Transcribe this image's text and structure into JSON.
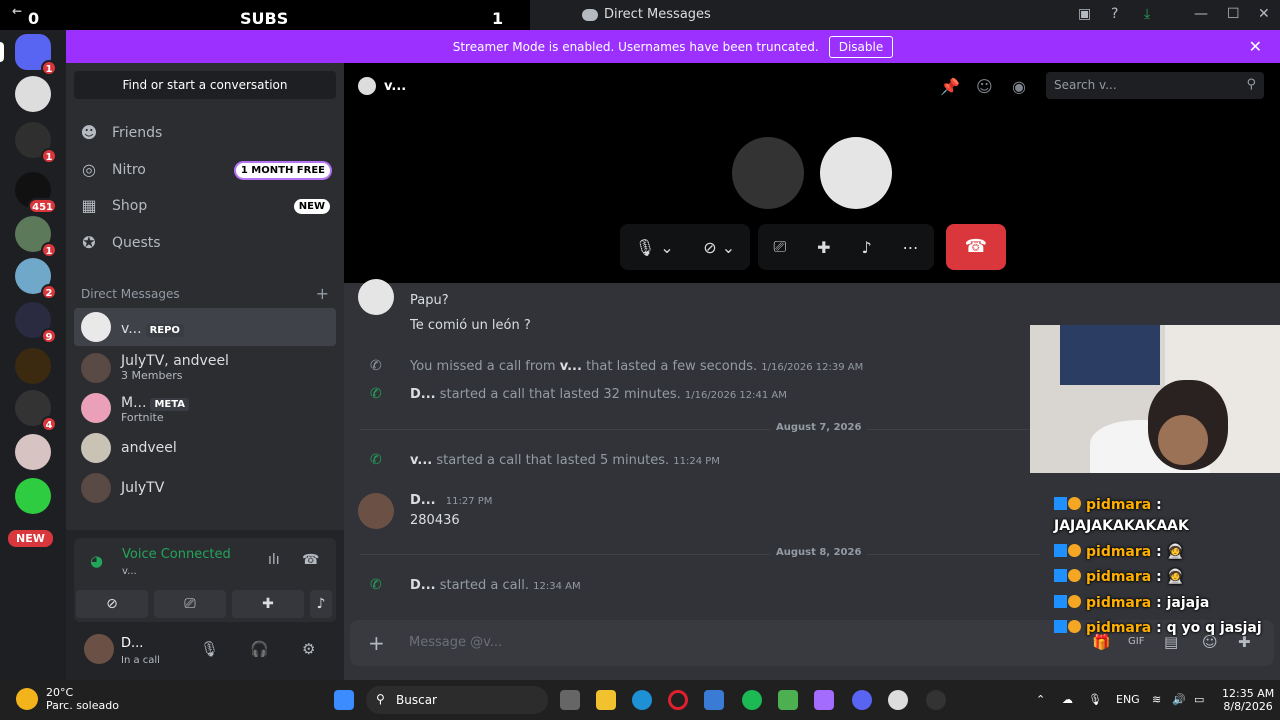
{
  "overlay": {
    "left_count": "0",
    "label": "SUBS",
    "right_count": "1"
  },
  "window": {
    "title": "Direct Messages"
  },
  "banner": {
    "text": "Streamer Mode is enabled. Usernames have been truncated.",
    "button": "Disable"
  },
  "server_badges": [
    "1",
    "1",
    "451",
    "1",
    "2",
    "9",
    "4"
  ],
  "server_new": "NEW",
  "sidebar": {
    "find": "Find or start a conversation",
    "nav": [
      {
        "label": "Friends",
        "tag": ""
      },
      {
        "label": "Nitro",
        "tag": "1 MONTH FREE"
      },
      {
        "label": "Shop",
        "tag": "NEW"
      },
      {
        "label": "Quests",
        "tag": ""
      }
    ],
    "dm_header": "Direct Messages",
    "dms": [
      {
        "name": "v...",
        "chip": "REPO",
        "sub": ""
      },
      {
        "name": "JulyTV, andveel",
        "chip": "",
        "sub": "3 Members"
      },
      {
        "name": "M...",
        "chip": "META",
        "sub": "Fortnite"
      },
      {
        "name": "andveel",
        "chip": "",
        "sub": ""
      },
      {
        "name": "JulyTV",
        "chip": "",
        "sub": ""
      }
    ]
  },
  "voice": {
    "status": "Voice Connected",
    "channel": "v..."
  },
  "user": {
    "name": "D...",
    "status": "In a call"
  },
  "chat_header": {
    "name": "v...",
    "search_placeholder": "Search v..."
  },
  "messages": {
    "m1_line1": "Papu?",
    "m1_line2": "Te comió un león ?",
    "call1": {
      "pre": "You missed a call from ",
      "who": "v...",
      "post": " that lasted a few seconds.",
      "ts": "1/16/2026 12:39 AM"
    },
    "call2": {
      "who": "D...",
      "post": " started a call that lasted 32 minutes.",
      "ts": "1/16/2026 12:41 AM"
    },
    "date1": "August 7, 2026",
    "call3": {
      "who": "v...",
      "post": " started a call that lasted 5 minutes.",
      "ts": "11:24 PM"
    },
    "msg": {
      "author": "D...",
      "ts": "11:27 PM",
      "text": "280436"
    },
    "date2": "August 8, 2026",
    "call4": {
      "who": "D...",
      "post": " started a call.",
      "ts": "12:34 AM"
    }
  },
  "composer": {
    "placeholder": "Message @v..."
  },
  "stream_chat": [
    {
      "user": "pidmara",
      "text": " : "
    },
    {
      "user": "",
      "text": "JAJAJAKAKAKAAK"
    },
    {
      "user": "pidmara",
      "text": " : 🧑‍🚀"
    },
    {
      "user": "pidmara",
      "text": " : 🧑‍🚀"
    },
    {
      "user": "pidmara",
      "text": " : jajaja"
    },
    {
      "user": "pidmara",
      "text": " : q yo q jasjaj"
    }
  ],
  "taskbar": {
    "temp": "20°C",
    "weather": "Parc. soleado",
    "search": "Buscar",
    "lang": "ENG",
    "time": "12:35 AM",
    "date": "8/8/2026"
  },
  "colors": {
    "accent": "#5865f2",
    "banner": "#9b30ff",
    "danger": "#da373c",
    "online": "#23a55a"
  }
}
